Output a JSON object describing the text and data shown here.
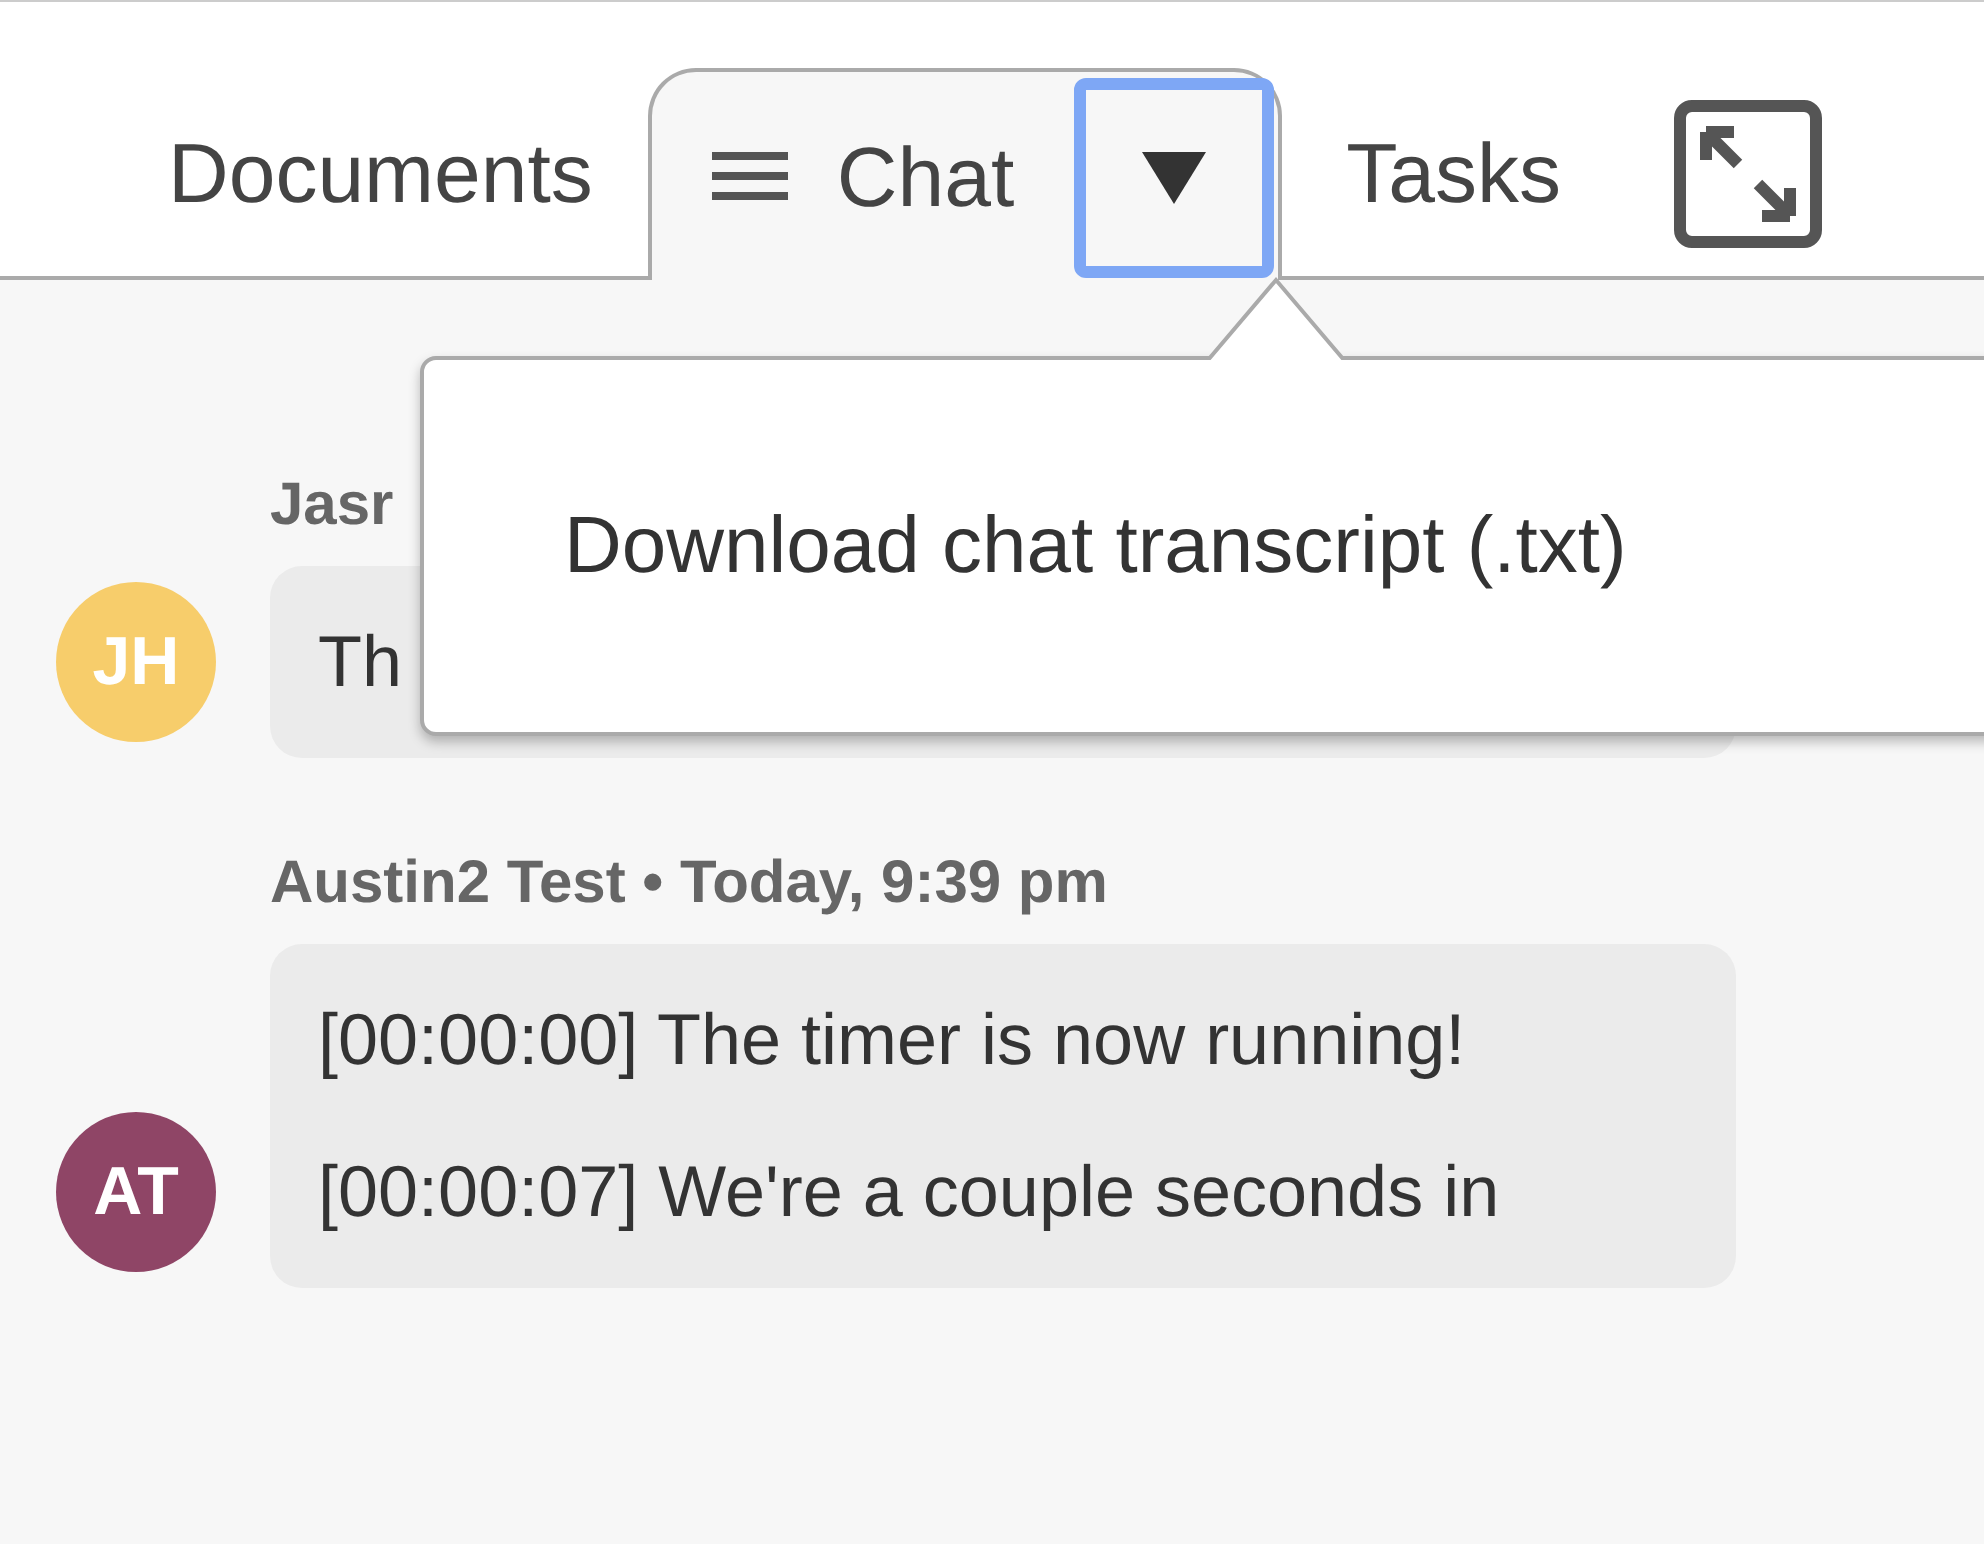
{
  "tabs": [
    {
      "label": "Documents",
      "selected": false,
      "kind": "plain"
    },
    {
      "label": "Chat",
      "selected": true,
      "kind": "menu"
    },
    {
      "label": "Tasks",
      "selected": false,
      "kind": "plain"
    }
  ],
  "menu": {
    "items": [
      "Download chat transcript (.txt)"
    ]
  },
  "messages": [
    {
      "sender": "Jasr",
      "initials": "JH",
      "color": "#f7cd6b",
      "paragraphs": [
        "Th"
      ]
    },
    {
      "sender": "Austin2 Test • Today, 9:39 pm",
      "initials": "AT",
      "color": "#8f4566",
      "paragraphs": [
        "[00:00:00] The timer is now running!",
        "[00:00:07] We're a couple seconds in"
      ]
    }
  ]
}
